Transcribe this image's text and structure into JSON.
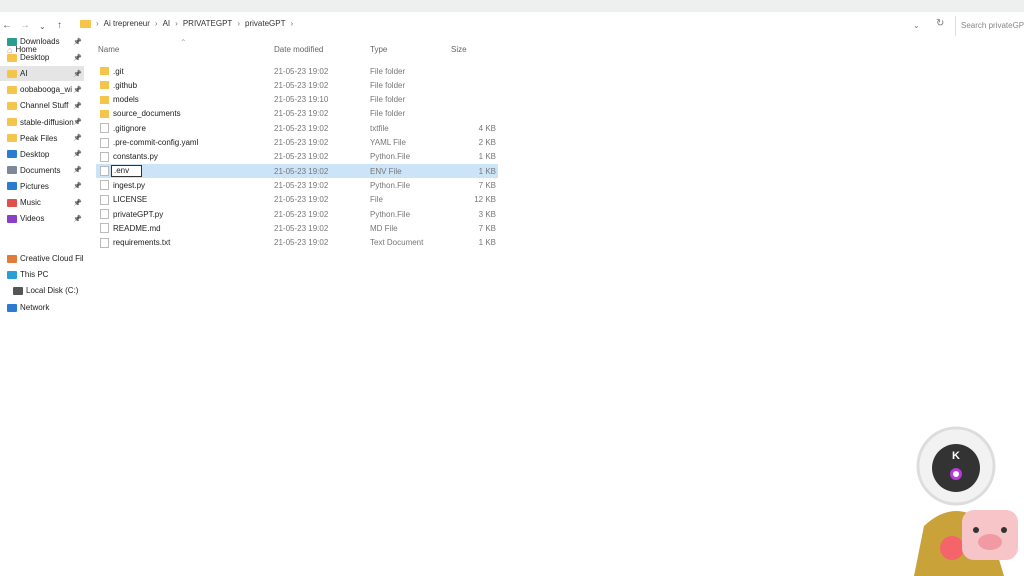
{
  "breadcrumb": [
    "Ai trepreneur",
    "AI",
    "PRIVATEGPT",
    "privateGPT"
  ],
  "search": {
    "placeholder": "Search privateGPT"
  },
  "sidebar": {
    "home": "Home",
    "quick": [
      {
        "label": "Downloads",
        "color": "#2a9d8f"
      },
      {
        "label": "Desktop",
        "color": "#f5c44a"
      },
      {
        "label": "AI",
        "color": "#f5c44a"
      },
      {
        "label": "oobabooga_wi",
        "color": "#f5c44a"
      },
      {
        "label": "Channel Stuff",
        "color": "#f5c44a"
      },
      {
        "label": "stable-diffusion",
        "color": "#f5c44a"
      },
      {
        "label": "Peak Files",
        "color": "#f5c44a"
      },
      {
        "label": "Desktop",
        "color": "#2b7bd1"
      },
      {
        "label": "Documents",
        "color": "#7a8a9a"
      },
      {
        "label": "Pictures",
        "color": "#2b7bd1"
      },
      {
        "label": "Music",
        "color": "#e0504a"
      },
      {
        "label": "Videos",
        "color": "#8a3fc7"
      }
    ],
    "other": [
      {
        "label": "Creative Cloud Files",
        "color": "#e07b39"
      },
      {
        "label": "This PC",
        "color": "#2b9fd1"
      },
      {
        "label": "Local Disk (C:)",
        "color": "#555"
      },
      {
        "label": "Network",
        "color": "#2b7bd1"
      }
    ]
  },
  "columns": {
    "name": "Name",
    "date": "Date modified",
    "type": "Type",
    "size": "Size"
  },
  "files": [
    {
      "name": ".git",
      "date": "21-05-23 19:02",
      "type": "File folder",
      "size": "",
      "folder": true
    },
    {
      "name": ".github",
      "date": "21-05-23 19:02",
      "type": "File folder",
      "size": "",
      "folder": true
    },
    {
      "name": "models",
      "date": "21-05-23 19:10",
      "type": "File folder",
      "size": "",
      "folder": true
    },
    {
      "name": "source_documents",
      "date": "21-05-23 19:02",
      "type": "File folder",
      "size": "",
      "folder": true
    },
    {
      "name": ".gitignore",
      "date": "21-05-23 19:02",
      "type": "txtfile",
      "size": "4 KB"
    },
    {
      "name": ".pre-commit-config.yaml",
      "date": "21-05-23 19:02",
      "type": "YAML File",
      "size": "2 KB"
    },
    {
      "name": "constants.py",
      "date": "21-05-23 19:02",
      "type": "Python.File",
      "size": "1 KB"
    },
    {
      "name": ".env",
      "date": "21-05-23 19:02",
      "type": "ENV File",
      "size": "1 KB",
      "selected": true
    },
    {
      "name": "ingest.py",
      "date": "21-05-23 19:02",
      "type": "Python.File",
      "size": "7 KB"
    },
    {
      "name": "LICENSE",
      "date": "21-05-23 19:02",
      "type": "File",
      "size": "12 KB"
    },
    {
      "name": "privateGPT.py",
      "date": "21-05-23 19:02",
      "type": "Python.File",
      "size": "3 KB"
    },
    {
      "name": "README.md",
      "date": "21-05-23 19:02",
      "type": "MD File",
      "size": "7 KB"
    },
    {
      "name": "requirements.txt",
      "date": "21-05-23 19:02",
      "type": "Text Document",
      "size": "1 KB"
    }
  ],
  "overlay": {
    "badge": "K"
  }
}
